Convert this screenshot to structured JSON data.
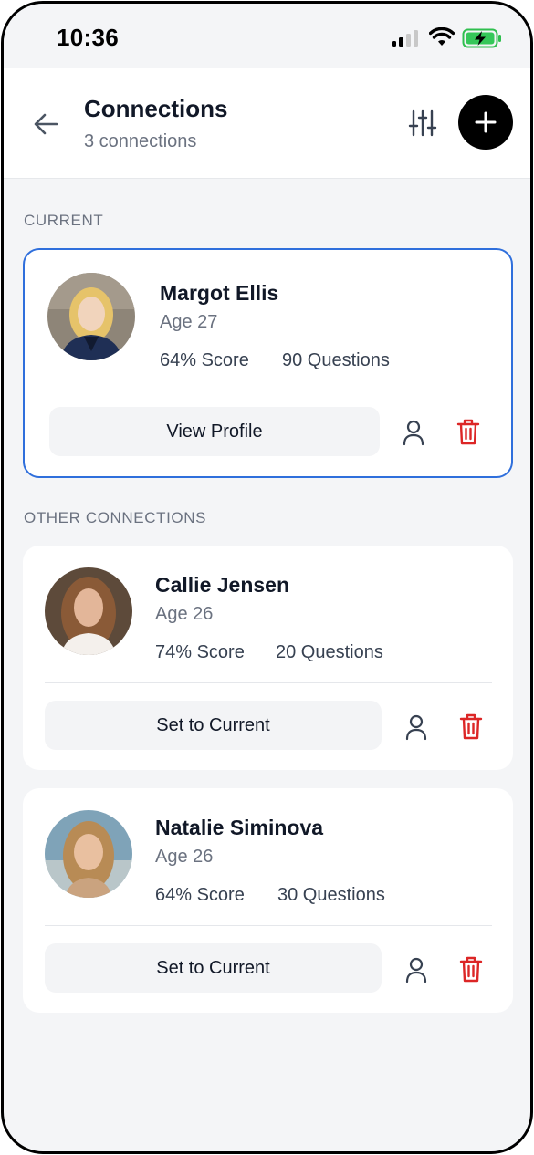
{
  "status_bar": {
    "time": "10:36"
  },
  "header": {
    "title": "Connections",
    "subtitle": "3 connections"
  },
  "sections": {
    "current": "CURRENT",
    "other": "OTHER CONNECTIONS"
  },
  "current": {
    "name": "Margot Ellis",
    "age": "Age 27",
    "score": "64% Score",
    "questions": "90 Questions",
    "action": "View Profile"
  },
  "others": [
    {
      "name": "Callie Jensen",
      "age": "Age 26",
      "score": "74% Score",
      "questions": "20 Questions",
      "action": "Set to Current"
    },
    {
      "name": "Natalie Siminova",
      "age": "Age 26",
      "score": "64% Score",
      "questions": "30 Questions",
      "action": "Set to Current"
    }
  ],
  "icons": [
    "back-arrow-icon",
    "filter-sliders-icon",
    "plus-icon",
    "person-icon",
    "trash-icon"
  ],
  "colors": {
    "accent": "#2f6fdc",
    "delete": "#dc2626",
    "add_button": "#000000"
  }
}
